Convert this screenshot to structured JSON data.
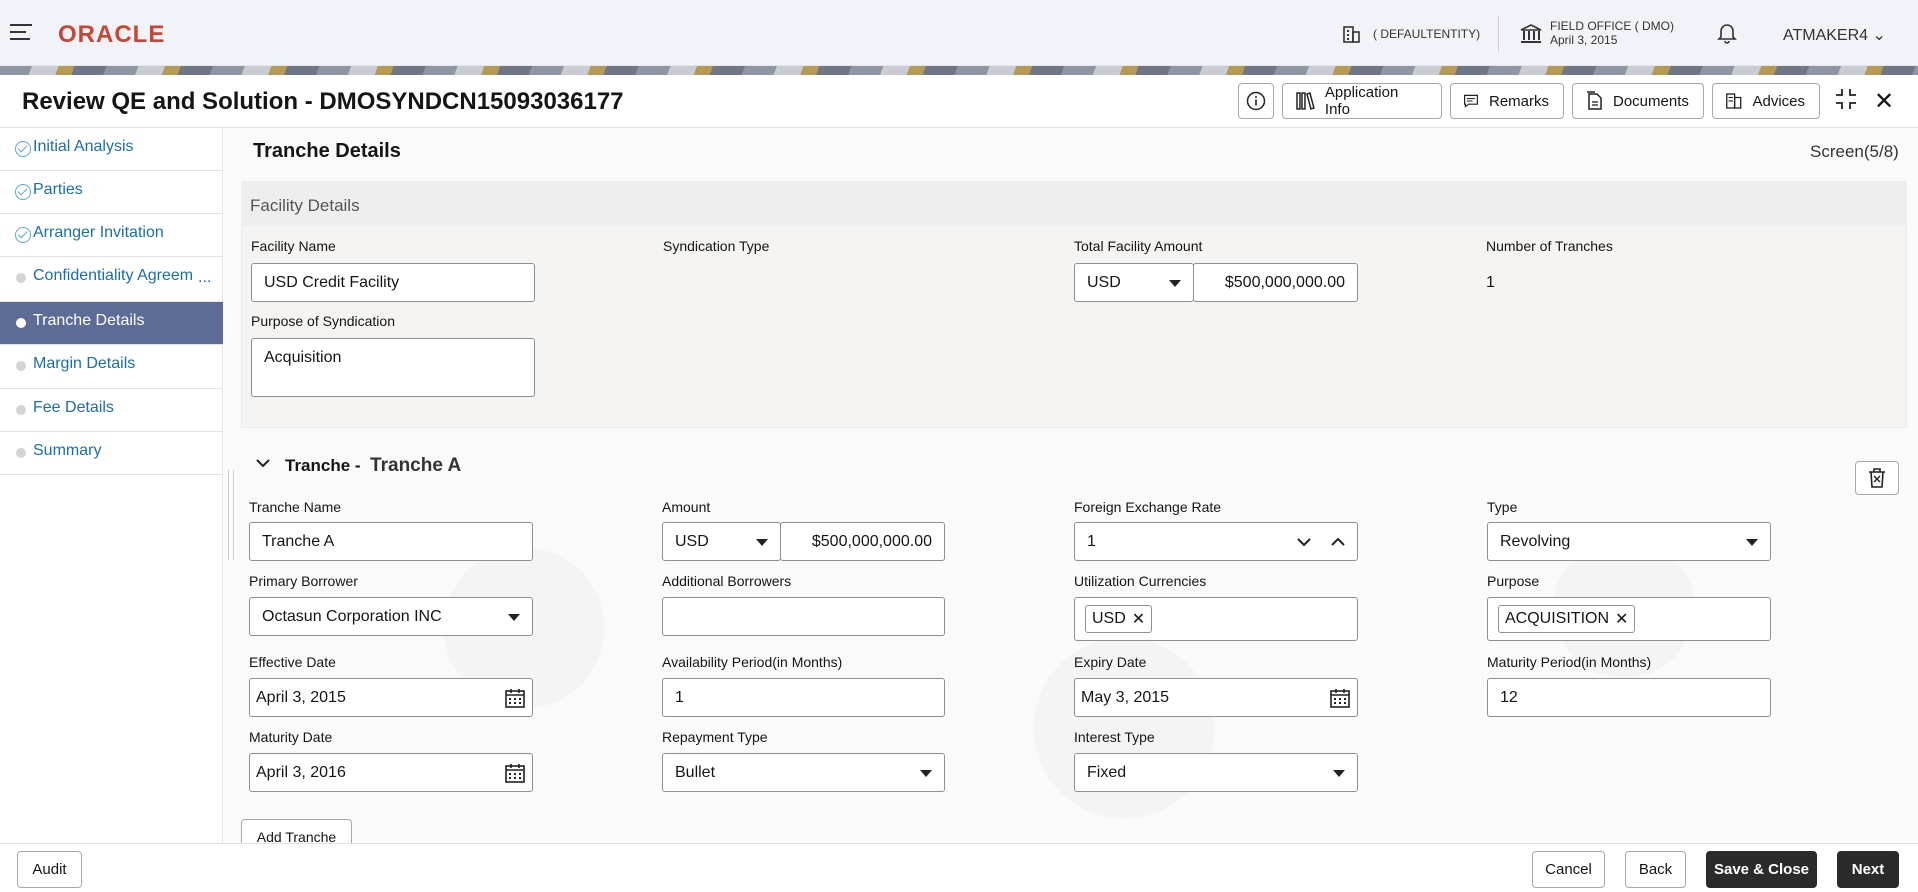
{
  "header": {
    "logo": "ORACLE",
    "entity": "( DEFAULTENTITY)",
    "office_name": "FIELD OFFICE ( DMO)",
    "office_date": "April 3, 2015",
    "user": "ATMAKER4"
  },
  "title": {
    "text": "Review QE and Solution - DMOSYNDCN15093036177",
    "buttons": {
      "app_info": "Application Info",
      "remarks": "Remarks",
      "documents": "Documents",
      "advices": "Advices"
    }
  },
  "sidebar": {
    "steps": [
      {
        "label": "Initial Analysis",
        "status": "done"
      },
      {
        "label": "Parties",
        "status": "done"
      },
      {
        "label": "Arranger Invitation",
        "status": "done"
      },
      {
        "label": "Confidentiality Agreem",
        "status": "pending"
      },
      {
        "label": "Tranche Details",
        "status": "active"
      },
      {
        "label": "Margin Details",
        "status": "pending"
      },
      {
        "label": "Fee Details",
        "status": "pending"
      },
      {
        "label": "Summary",
        "status": "pending"
      }
    ],
    "ellipsis": "..."
  },
  "main": {
    "section_title": "Tranche Details",
    "screen_indicator": "Screen(5/8)",
    "facility": {
      "panel_title": "Facility Details",
      "facility_name_label": "Facility Name",
      "facility_name": "USD Credit Facility",
      "syndication_type_label": "Syndication Type",
      "total_amount_label": "Total Facility Amount",
      "total_currency": "USD",
      "total_amount": "$500,000,000.00",
      "num_tranches_label": "Number of Tranches",
      "num_tranches": "1",
      "purpose_label": "Purpose of Syndication",
      "purpose": "Acquisition"
    },
    "tranche": {
      "header_prefix": "Tranche -",
      "header_name": "Tranche A",
      "name_label": "Tranche Name",
      "name": "Tranche A",
      "amount_label": "Amount",
      "amount_currency": "USD",
      "amount": "$500,000,000.00",
      "fx_label": "Foreign Exchange Rate",
      "fx": "1",
      "type_label": "Type",
      "type": "Revolving",
      "primary_borrower_label": "Primary Borrower",
      "primary_borrower": "Octasun Corporation INC",
      "additional_borrowers_label": "Additional Borrowers",
      "additional_borrowers": "",
      "util_currencies_label": "Utilization Currencies",
      "util_currency_chip": "USD",
      "purpose_label": "Purpose",
      "purpose_chip": "ACQUISITION",
      "effective_date_label": "Effective Date",
      "effective_date": "April 3, 2015",
      "availability_label": "Availability Period(in Months)",
      "availability": "1",
      "expiry_date_label": "Expiry Date",
      "expiry_date": "May 3, 2015",
      "maturity_period_label": "Maturity Period(in Months)",
      "maturity_period": "12",
      "maturity_date_label": "Maturity Date",
      "maturity_date": "April 3, 2016",
      "repayment_label": "Repayment Type",
      "repayment": "Bullet",
      "interest_label": "Interest Type",
      "interest": "Fixed"
    },
    "add_tranche": "Add Tranche"
  },
  "footer": {
    "audit": "Audit",
    "cancel": "Cancel",
    "back": "Back",
    "save_close": "Save & Close",
    "next": "Next"
  },
  "colors": {
    "brand": "#c74634",
    "active_step": "#5c6c96",
    "link": "#1a6fa5",
    "primary_button": "#2b2b2b"
  }
}
